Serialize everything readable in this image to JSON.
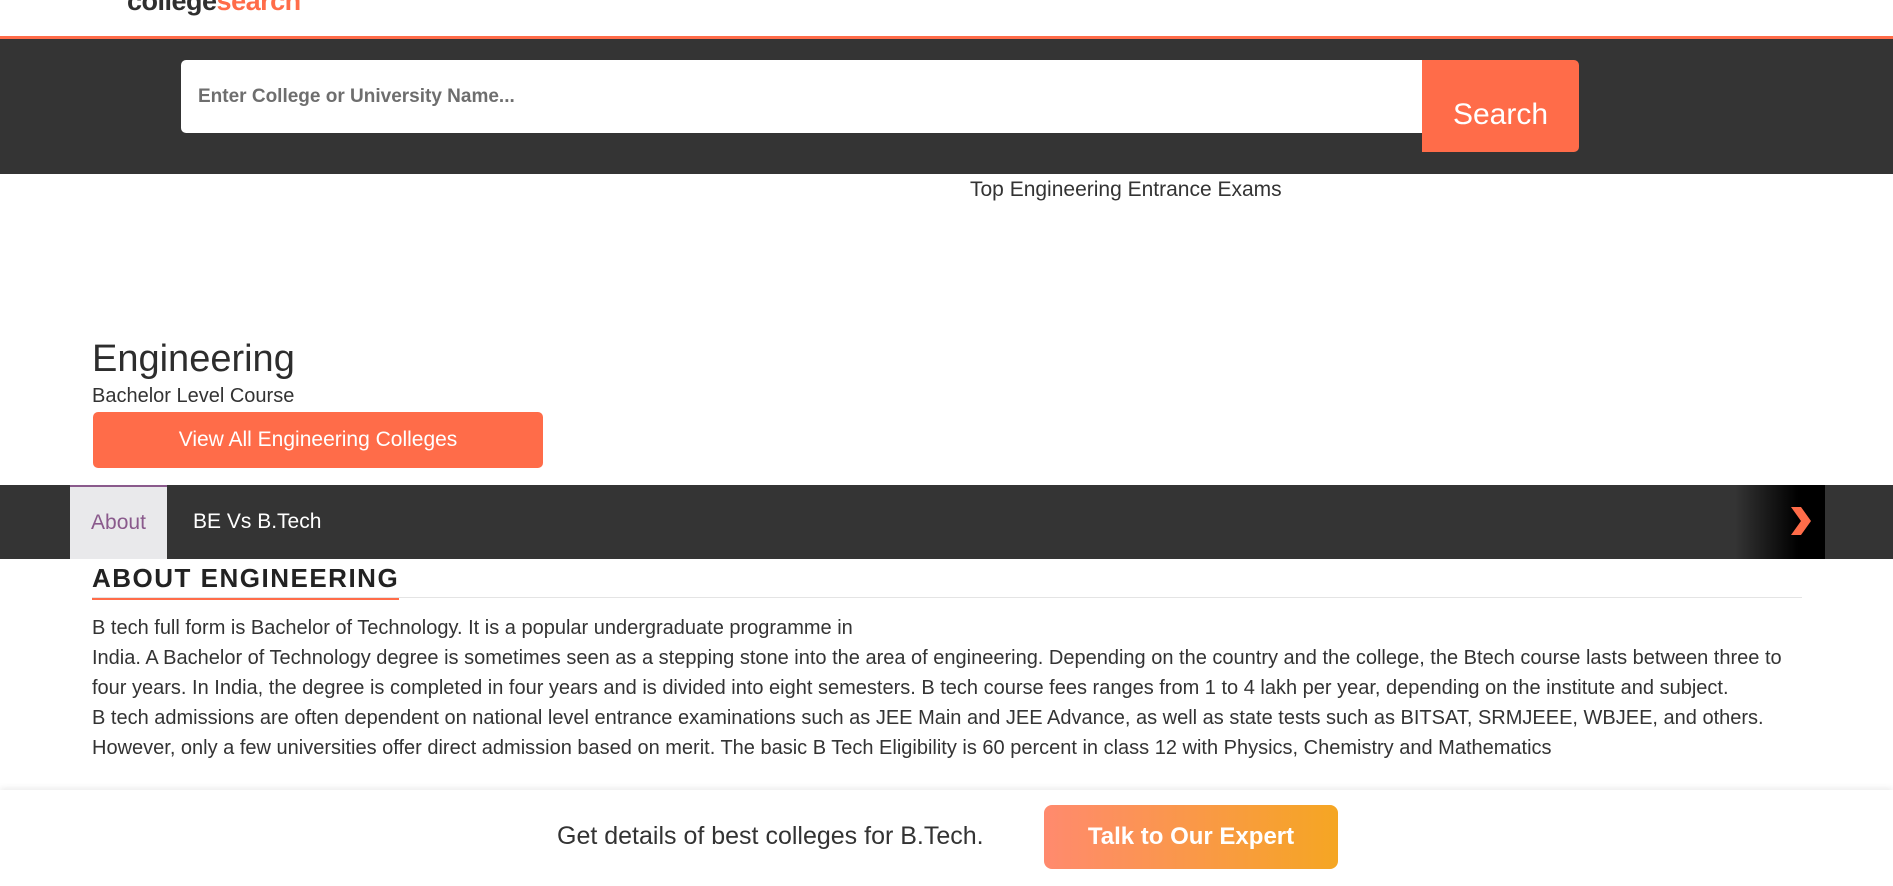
{
  "header": {
    "logo_part1": "college",
    "logo_part2": "search"
  },
  "search": {
    "placeholder": "Enter College or University Name...",
    "button_label": "Search"
  },
  "exams_link": "Top Engineering Entrance Exams",
  "course": {
    "title": "Engineering",
    "level": "Bachelor Level Course",
    "view_all_label": "View All Engineering Colleges"
  },
  "tabs": [
    {
      "label": "About",
      "active": true
    },
    {
      "label": "BE Vs B.Tech",
      "active": false
    }
  ],
  "about": {
    "heading": "ABOUT ENGINEERING",
    "paragraphs": [
      "B tech full form is Bachelor of Technology. It is a popular undergraduate programme in",
      "India. A Bachelor of Technology degree is sometimes seen as a stepping stone into the area of engineering. Depending on the country and the college, the Btech course lasts between three to four years. In India, the degree is completed in four years and is divided into eight semesters. B tech course fees ranges from 1 to 4 lakh per year, depending on the institute and subject.",
      "B tech admissions are often dependent on national level entrance examinations such as JEE Main and JEE Advance, as well as state tests such as BITSAT, SRMJEEE, WBJEE, and others. However, only a few universities offer direct admission based on merit. The basic B Tech Eligibility is 60 percent in class 12 with Physics, Chemistry and Mathematics"
    ]
  },
  "cta": {
    "text": "Get details of best colleges for B.Tech.",
    "button_label": "Talk to Our Expert"
  },
  "colors": {
    "accent": "#ff6c49",
    "dark_band": "#343434",
    "active_tab_text": "#8a5a8c",
    "cta_gradient_start": "#ff8a6e",
    "cta_gradient_end": "#f5a623"
  },
  "icons": {
    "tab_scroll": "chevron-right-icon"
  }
}
